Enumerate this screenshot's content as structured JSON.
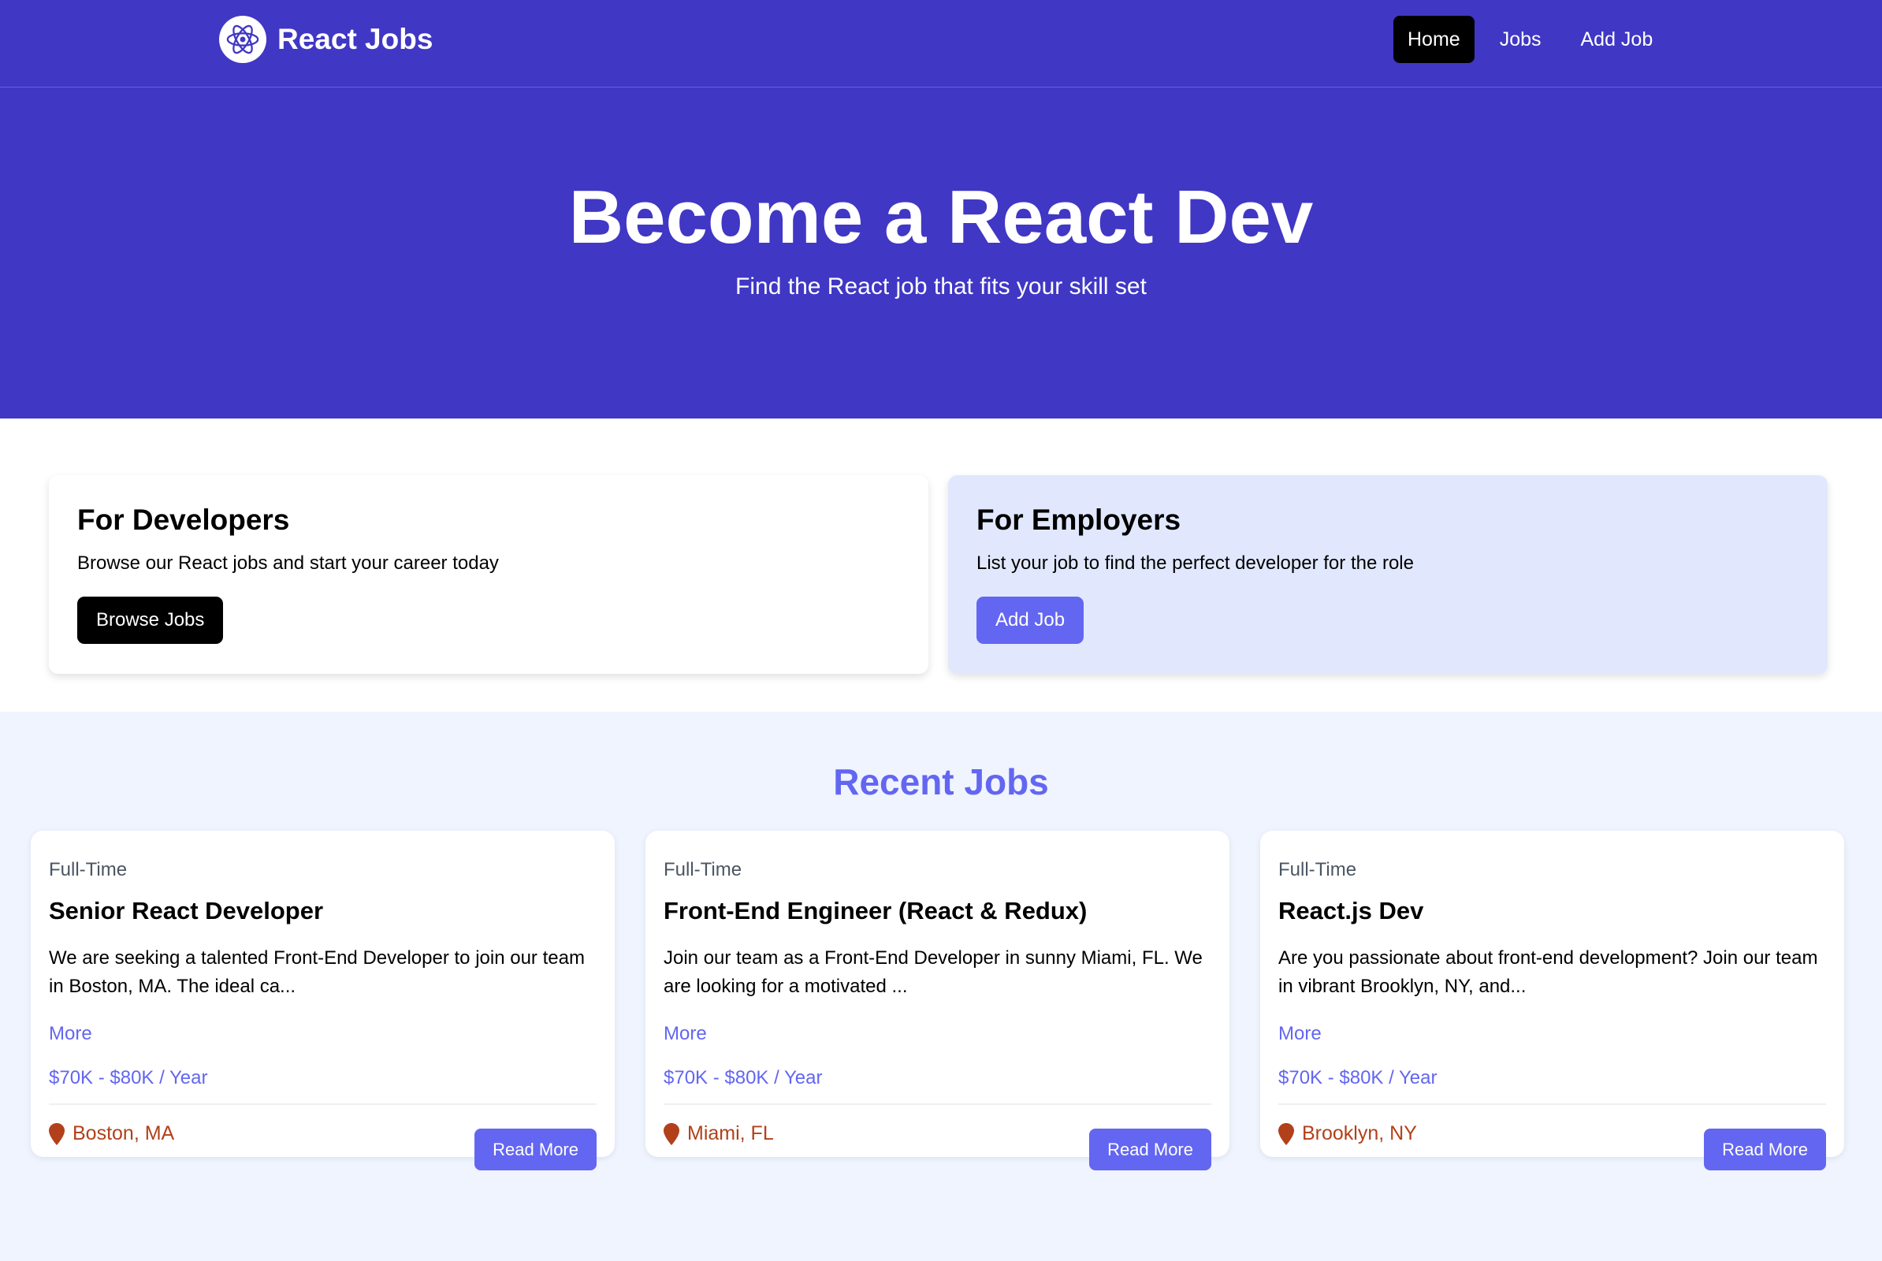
{
  "nav": {
    "brand": "React Jobs",
    "links": [
      {
        "label": "Home",
        "active": true
      },
      {
        "label": "Jobs",
        "active": false
      },
      {
        "label": "Add Job",
        "active": false
      }
    ]
  },
  "hero": {
    "title": "Become a React Dev",
    "subtitle": "Find the React job that fits your skill set"
  },
  "cards": {
    "developers": {
      "title": "For Developers",
      "text": "Browse our React jobs and start your career today",
      "button": "Browse Jobs"
    },
    "employers": {
      "title": "For Employers",
      "text": "List your job to find the perfect developer for the role",
      "button": "Add Job"
    }
  },
  "recent": {
    "heading": "Recent Jobs",
    "jobs": [
      {
        "type": "Full-Time",
        "title": "Senior React Developer",
        "description": "We are seeking a talented Front-End Developer to join our team in Boston, MA. The ideal ca...",
        "more": "More",
        "salary": "$70K - $80K / Year",
        "location": "Boston, MA",
        "button": "Read More"
      },
      {
        "type": "Full-Time",
        "title": "Front-End Engineer (React & Redux)",
        "description": "Join our team as a Front-End Developer in sunny Miami, FL. We are looking for a motivated ...",
        "more": "More",
        "salary": "$70K - $80K / Year",
        "location": "Miami, FL",
        "button": "Read More"
      },
      {
        "type": "Full-Time",
        "title": "React.js Dev",
        "description": "Are you passionate about front-end development? Join our team in vibrant Brooklyn, NY, and...",
        "more": "More",
        "salary": "$70K - $80K / Year",
        "location": "Brooklyn, NY",
        "button": "Read More"
      }
    ]
  },
  "colors": {
    "primary": "#4037c5",
    "accent": "#6366f1",
    "location": "#b2401a",
    "employer_card": "#e1e8fd"
  },
  "icons": {
    "logo": "react-atom-icon",
    "location": "map-marker-icon"
  }
}
